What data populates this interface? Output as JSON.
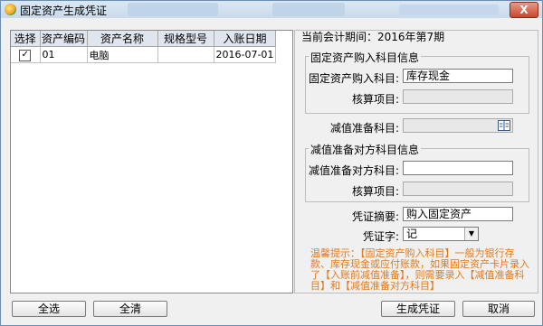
{
  "window": {
    "title": "固定资产生成凭证",
    "close_label": "X"
  },
  "table": {
    "headers": [
      "选择",
      "资产编码",
      "资产名称",
      "规格型号",
      "入账日期"
    ],
    "rows": [
      {
        "checked": "✓",
        "code": "01",
        "name": "电脑",
        "spec": "",
        "date": "2016-07-01"
      }
    ]
  },
  "period": {
    "label": "当前会计期间：2016年第7期"
  },
  "purchase_group": {
    "title": "固定资产购入科目信息",
    "subject_label": "固定资产购入科目:",
    "subject_value": "库存现金",
    "audit_label": "核算项目:",
    "audit_value": ""
  },
  "impairment": {
    "label": "减值准备科目:",
    "value": ""
  },
  "impairment_group": {
    "title": "减值准备对方科目信息",
    "subject_label": "减值准备对方科目:",
    "subject_value": "",
    "audit_label": "核算项目:",
    "audit_value": ""
  },
  "voucher": {
    "summary_label": "凭证摘要:",
    "summary_value": "购入固定资产",
    "word_label": "凭证字:",
    "word_value": "记"
  },
  "hint": "温馨提示：【固定资产购入科目】一般为银行存款、库存现金或应付账款，如果固定资产卡片录入了【入账前减值准备】，则需要录入【减值准备科目】和【减值准备对方科目】",
  "buttons": {
    "select_all": "全选",
    "clear_all": "全清",
    "generate": "生成凭证",
    "cancel": "取消"
  }
}
